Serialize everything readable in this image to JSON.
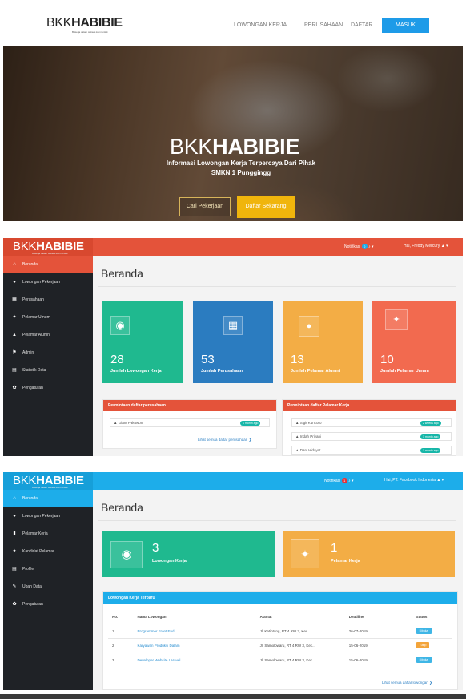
{
  "brand": {
    "thin": "BKK",
    "bold": "HABIBIE",
    "tagline": "Bekerja dalam sukses kami untuk"
  },
  "landing": {
    "nav": [
      "LOWONGAN KERJA",
      "PERUSAHAAN",
      "DAFTAR"
    ],
    "login_button": "MASUK",
    "hero_line1": "Informasi Lowongan Kerja Terpercaya Dari Pihak",
    "hero_line2": "SMKN 1 Punggingg",
    "btn_search": "Cari Pekerjaan",
    "btn_register": "Daftar Sekarang"
  },
  "admin": {
    "notif_label": "Notifikasi",
    "notif_count": "0",
    "user": "Hai, Freddy Mercury",
    "colors": {
      "topbar": "#e4533a"
    },
    "sidebar": [
      {
        "icon": "home-icon",
        "glyph": "⌂",
        "label": "Beranda",
        "active": true
      },
      {
        "icon": "eye-icon",
        "glyph": "●",
        "label": "Lowongan Pekerjaan"
      },
      {
        "icon": "building-icon",
        "glyph": "▦",
        "label": "Perusahaan"
      },
      {
        "icon": "users-icon",
        "glyph": "✦",
        "label": "Pelamar Umum"
      },
      {
        "icon": "user-icon",
        "glyph": "▲",
        "label": "Pelamar Alumni"
      },
      {
        "icon": "flag-icon",
        "glyph": "⚑",
        "label": "Admin"
      },
      {
        "icon": "chart-icon",
        "glyph": "▤",
        "label": "Statistik Data"
      },
      {
        "icon": "gear-icon",
        "glyph": "✿",
        "label": "Pengaturan"
      }
    ],
    "title": "Beranda",
    "cards": [
      {
        "value": "28",
        "label": "Jumlah Lowongan Kerja",
        "color": "#1fb98f",
        "icon": "eye-icon",
        "glyph": "◉"
      },
      {
        "value": "53",
        "label": "Jumlah Perusahaan",
        "color": "#2b7cc0",
        "icon": "building-icon",
        "glyph": "▦"
      },
      {
        "value": "13",
        "label": "Jumlah Pelamar Alumni",
        "color": "#f3ad45",
        "icon": "user-icon",
        "glyph": "●"
      },
      {
        "value": "10",
        "label": "Jumlah Pelamar Umum",
        "color": "#f26a4f",
        "icon": "users-icon",
        "glyph": "✦"
      }
    ],
    "company_requests": {
      "title": "Permintaan daftar perusahaan",
      "rows": [
        {
          "name": "Giant Pakuwon",
          "time": "1 month ago"
        }
      ],
      "link": "Lihat semua daftar perusahaan ❯"
    },
    "applicant_requests": {
      "title": "Permintaan daftar Pelamar Kerja",
      "rows": [
        {
          "name": "Sigit Kuncoro",
          "time": "2 weeks ago"
        },
        {
          "name": "Indah Priyani",
          "time": "1 month ago"
        },
        {
          "name": "Dani Hidayat",
          "time": "1 month ago"
        }
      ]
    }
  },
  "company": {
    "notif_label": "Notifikasi",
    "notif_count": "1",
    "user": "Hai, PT. Facebook Indonesia",
    "colors": {
      "topbar": "#1dadea"
    },
    "sidebar": [
      {
        "icon": "home-icon",
        "glyph": "⌂",
        "label": "Beranda",
        "active": true
      },
      {
        "icon": "eye-icon",
        "glyph": "●",
        "label": "Lowongan Pekerjaan"
      },
      {
        "icon": "file-icon",
        "glyph": "▮",
        "label": "Pelamar Kerja"
      },
      {
        "icon": "users-icon",
        "glyph": "✦",
        "label": "Kandidat Pelamar"
      },
      {
        "icon": "image-icon",
        "glyph": "▤",
        "label": "Profile"
      },
      {
        "icon": "edit-icon",
        "glyph": "✎",
        "label": "Ubah Data"
      },
      {
        "icon": "gear-icon",
        "glyph": "✿",
        "label": "Pengaturan"
      }
    ],
    "title": "Beranda",
    "cards": [
      {
        "value": "3",
        "label": "Lowongan Kerja",
        "color": "#1fb98f",
        "icon": "eye-icon",
        "glyph": "◉"
      },
      {
        "value": "1",
        "label": "Pelamar Kerja",
        "color": "#f3ad45",
        "icon": "users-icon",
        "glyph": "✦"
      }
    ],
    "latest_jobs": {
      "title": "Lowongan Kerja Terbaru",
      "headers": [
        "No.",
        "Nama Lowongan",
        "Alamat",
        "Deadline",
        "Status"
      ],
      "rows": [
        {
          "no": "1",
          "name": "Programmer Front End",
          "address": "Jl. Ketintang, RT 4 RW 3, Kec...",
          "deadline": "26-07-2019",
          "status": "Dibuka",
          "status_color": "#3fb6e6"
        },
        {
          "no": "2",
          "name": "Karyawan Produksi Dalam",
          "address": "Jl. Samolowaru, RT 4 RW 3, Kec...",
          "deadline": "15-06-2019",
          "status": "Tutup",
          "status_color": "#f3a43a"
        },
        {
          "no": "3",
          "name": "Developer Website Laravel",
          "address": "Jl. Samolowaru, RT 4 RW 3, Kec...",
          "deadline": "15-06-2019",
          "status": "Dibuka",
          "status_color": "#3fb6e6"
        }
      ],
      "link": "Lihat semua daftar lowongan ❯"
    }
  }
}
